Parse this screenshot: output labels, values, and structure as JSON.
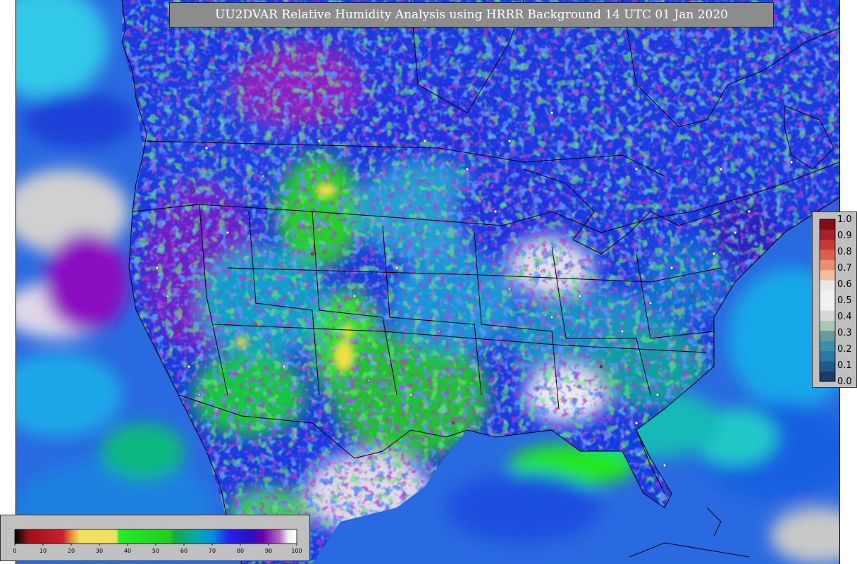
{
  "title": "UU2DVAR Relative Humidity Analysis using HRRR Background 14 UTC 01 Jan 2020",
  "colorbar": {
    "min": 0,
    "max": 100,
    "tick_labels": [
      "0",
      "10",
      "20",
      "30",
      "40",
      "50",
      "60",
      "70",
      "80",
      "90",
      "100"
    ],
    "stops": [
      {
        "v": 0,
        "c": "#000000"
      },
      {
        "v": 3,
        "c": "#5a0f0f"
      },
      {
        "v": 5,
        "c": "#a0101a"
      },
      {
        "v": 17,
        "c": "#c8202a"
      },
      {
        "v": 20,
        "c": "#e88a3a"
      },
      {
        "v": 23,
        "c": "#f0e060"
      },
      {
        "v": 36,
        "c": "#f0e060"
      },
      {
        "v": 37,
        "c": "#22ee22"
      },
      {
        "v": 55,
        "c": "#22cc22"
      },
      {
        "v": 57,
        "c": "#11aa44"
      },
      {
        "v": 64,
        "c": "#0aa8a8"
      },
      {
        "v": 70,
        "c": "#0090e0"
      },
      {
        "v": 76,
        "c": "#2222ee"
      },
      {
        "v": 84,
        "c": "#2a10c0"
      },
      {
        "v": 88,
        "c": "#6a00a8"
      },
      {
        "v": 94,
        "c": "#b070c0"
      },
      {
        "v": 97,
        "c": "#f0f0f0"
      },
      {
        "v": 100,
        "c": "#ffffff"
      }
    ]
  },
  "station_legend": {
    "tick_labels": [
      "0.0",
      "0.1",
      "0.2",
      "0.3",
      "0.4",
      "0.5",
      "0.6",
      "0.7",
      "0.8",
      "0.9",
      "1.0"
    ],
    "colors": [
      "#1a3a6a",
      "#1f5a8a",
      "#2a7aa0",
      "#3a90a8",
      "#6a9a9a",
      "#a8c8b0",
      "#d8d8d8",
      "#f0f0f0",
      "#f0f0f0",
      "#e8e8e8",
      "#f0c0a0",
      "#e89070",
      "#d86050",
      "#c83838",
      "#a82028",
      "#801018"
    ]
  }
}
